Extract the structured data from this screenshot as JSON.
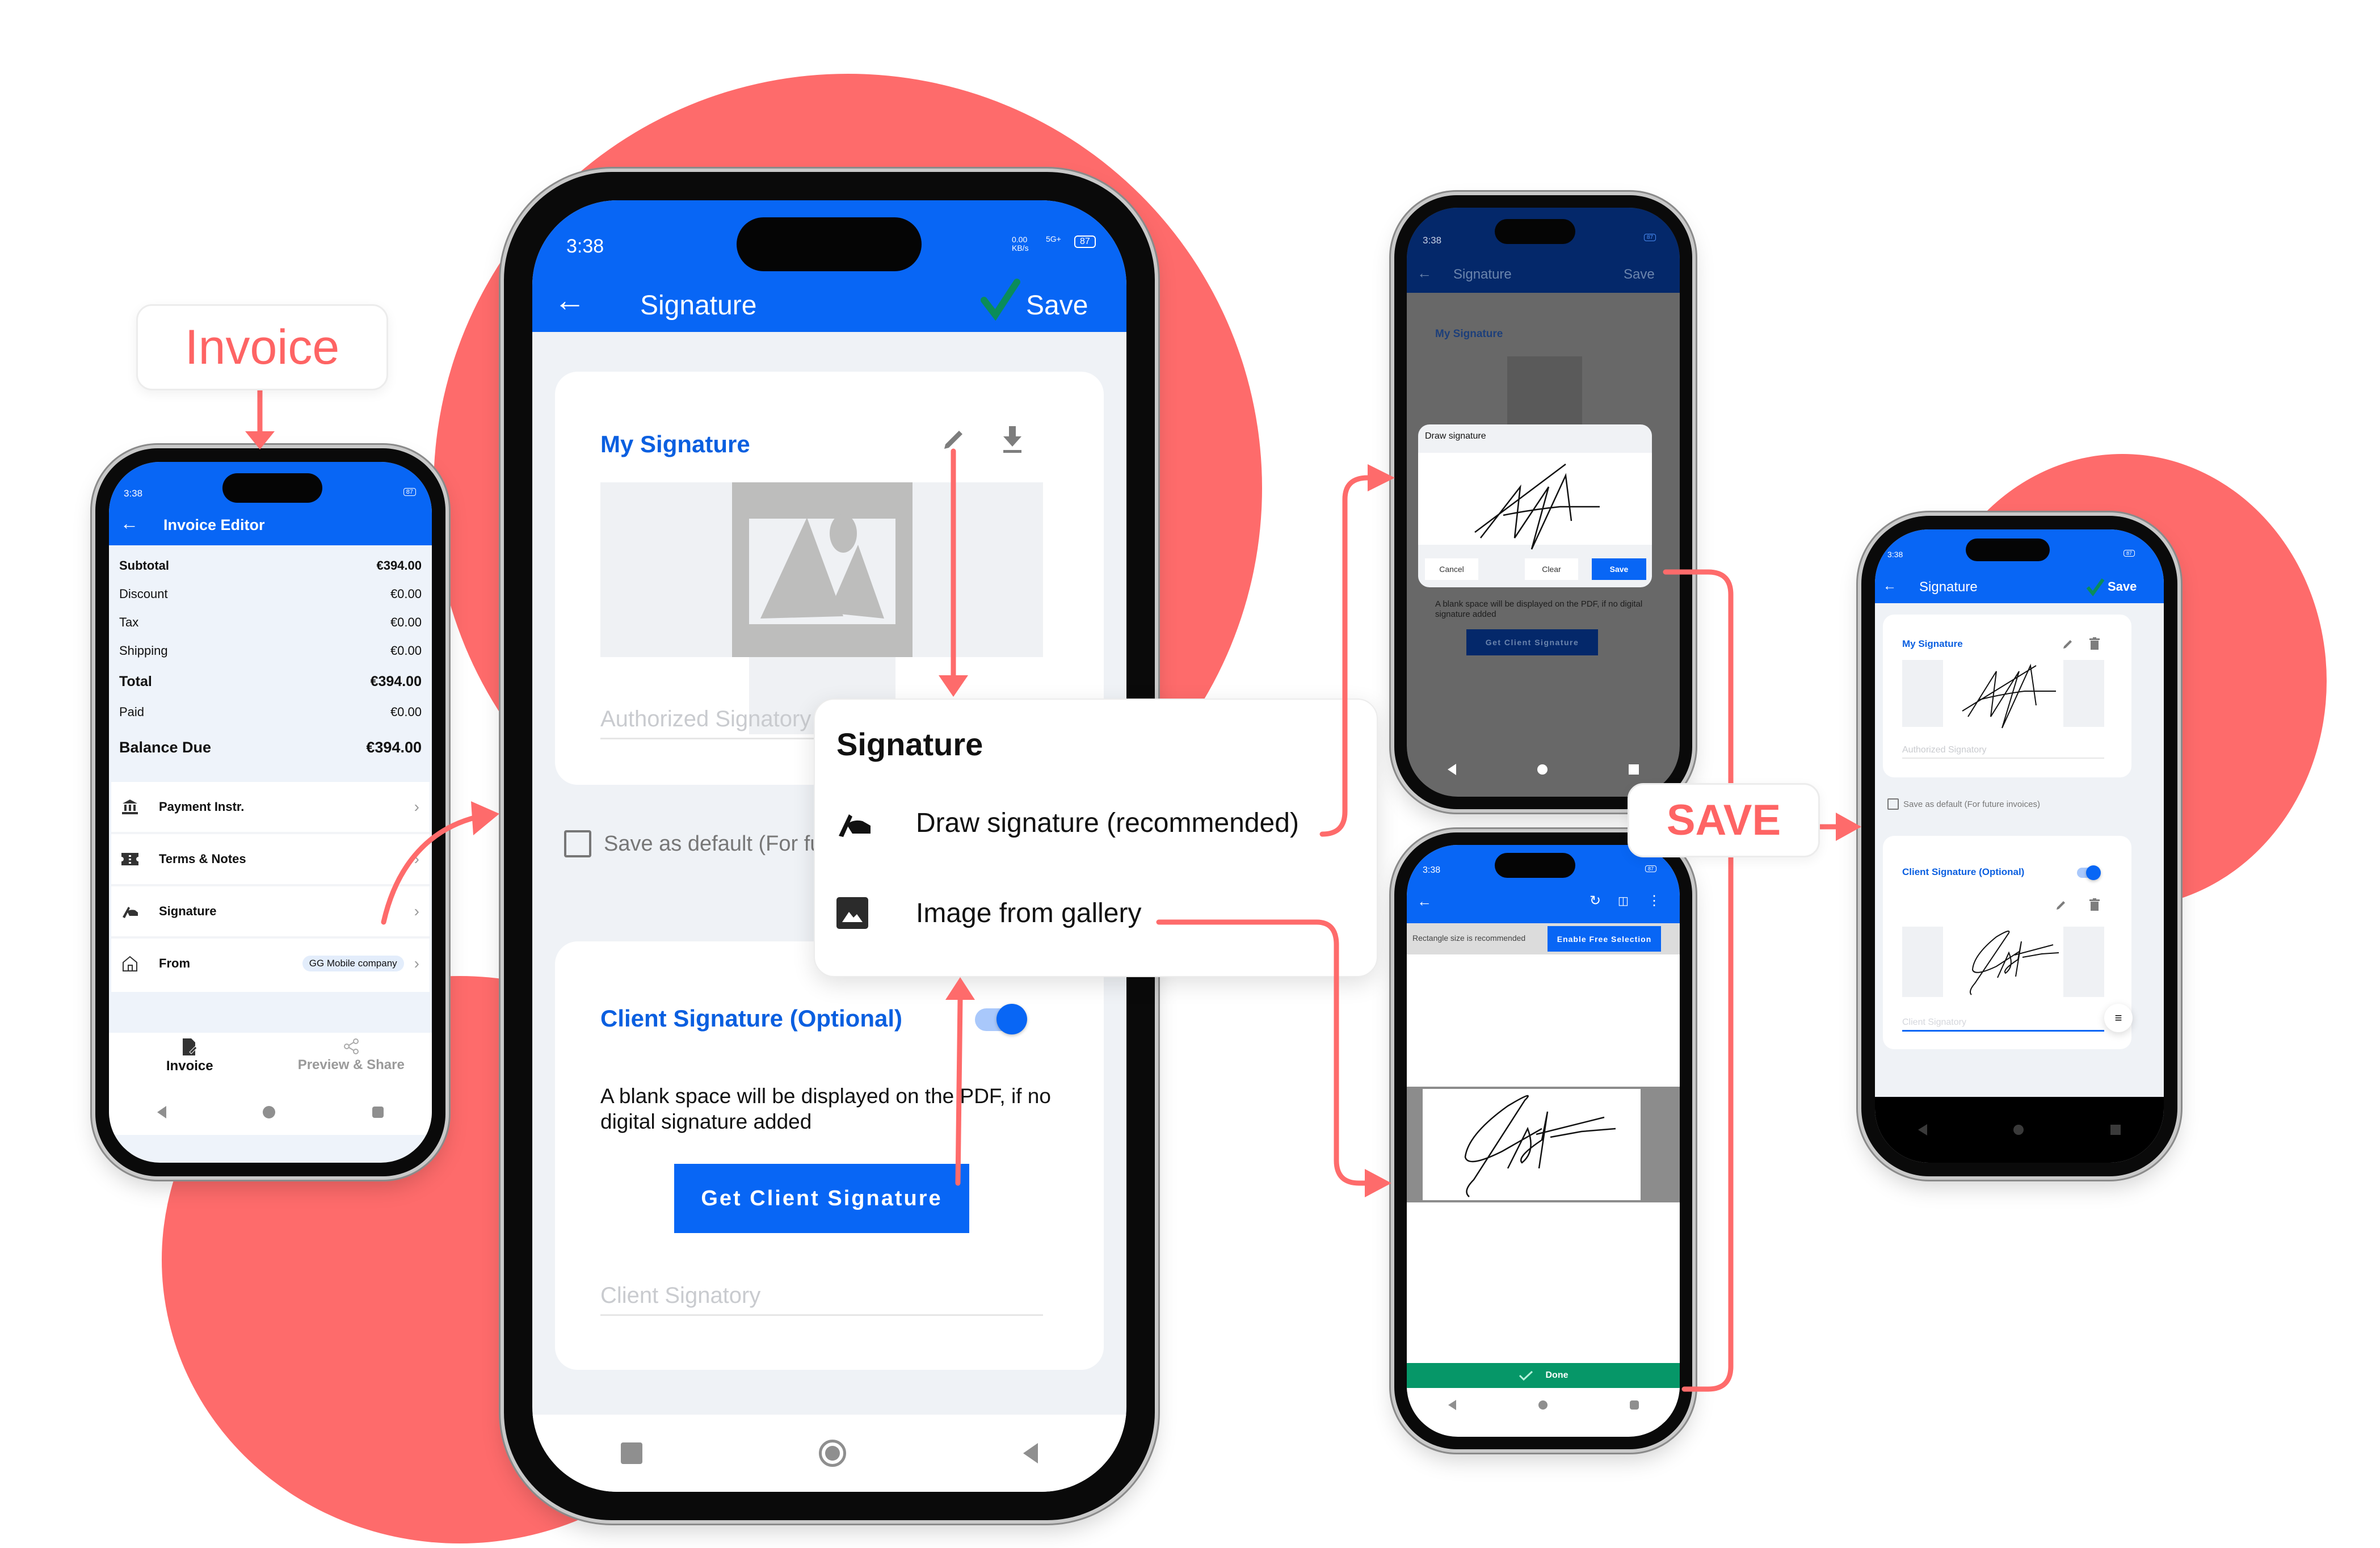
{
  "colors": {
    "accent_coral": "#fe6b6b",
    "brand_blue": "#0866f5",
    "done_green": "#069768",
    "check_green": "#0a8c5a"
  },
  "callouts": {
    "invoice_label": "Invoice",
    "save_label": "SAVE"
  },
  "status_bar": {
    "time": "3:38",
    "net_speed": "0.00 KB/s",
    "network": "5G+",
    "battery": "87"
  },
  "invoice_editor": {
    "title": "Invoice Editor",
    "totals": [
      {
        "label": "Subtotal",
        "value": "€394.00",
        "bold": true
      },
      {
        "label": "Discount",
        "value": "€0.00"
      },
      {
        "label": "Tax",
        "value": "€0.00"
      },
      {
        "label": "Shipping",
        "value": "€0.00"
      },
      {
        "label": "Total",
        "value": "€394.00",
        "bold": true
      },
      {
        "label": "Paid",
        "value": "€0.00"
      },
      {
        "label": "Balance Due",
        "value": "€394.00",
        "bold": true
      }
    ],
    "menu": [
      {
        "icon": "bank-icon",
        "label": "Payment Instr."
      },
      {
        "icon": "ticket-icon",
        "label": "Terms & Notes"
      },
      {
        "icon": "signature-hand-icon",
        "label": "Signature"
      },
      {
        "icon": "home-icon",
        "label": "From",
        "badge": "GG Mobile company"
      }
    ],
    "bottom_tabs": [
      {
        "icon": "invoice-doc-icon",
        "label": "Invoice",
        "active": true
      },
      {
        "icon": "share-icon",
        "label": "Preview & Share",
        "active": false
      }
    ]
  },
  "signature_screen": {
    "title": "Signature",
    "save_label": "Save",
    "my_signature_title": "My Signature",
    "authorized_placeholder": "Authorized Signatory",
    "save_default_label": "Save as default (For future invoices)",
    "save_default_checked": false,
    "client_signature_title": "Client Signature (Optional)",
    "client_signature_enabled": true,
    "blank_space_note": "A blank space will be displayed on the PDF, if no digital signature added",
    "get_client_signature_button": "Get Client Signature",
    "client_placeholder": "Client Signatory"
  },
  "signature_popup": {
    "title": "Signature",
    "options": [
      {
        "icon": "draw-signature-icon",
        "label": "Draw signature (recommended)"
      },
      {
        "icon": "gallery-image-icon",
        "label": "Image from gallery"
      }
    ]
  },
  "draw_dialog": {
    "title": "Draw signature",
    "cancel": "Cancel",
    "clear": "Clear",
    "save": "Save"
  },
  "crop_screen": {
    "hint": "Rectangle size is recommended",
    "free_selection_button": "Enable Free Selection",
    "done_button": "Done"
  }
}
